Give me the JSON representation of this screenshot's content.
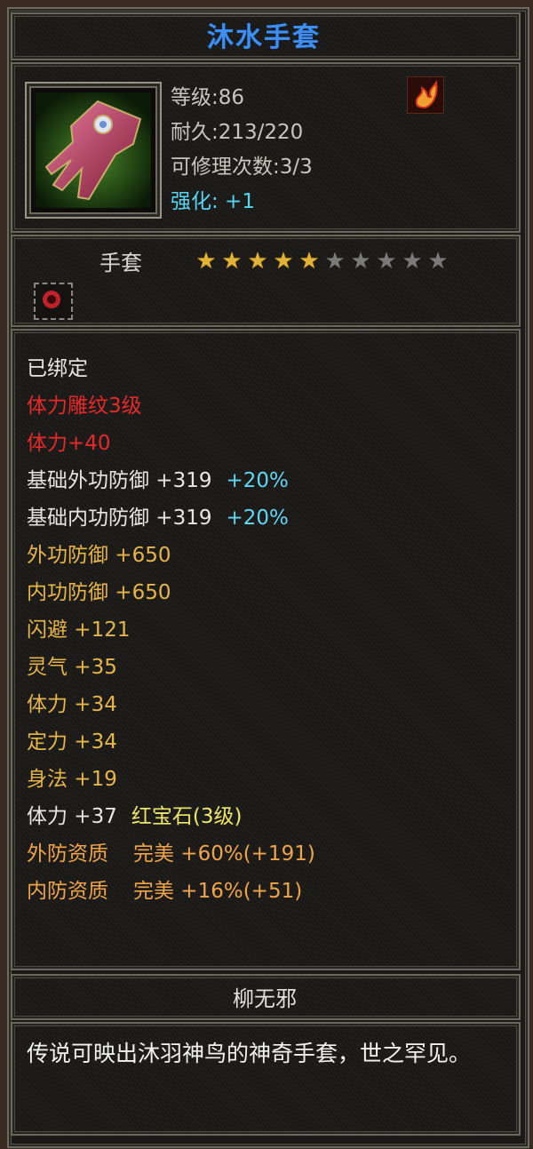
{
  "item": {
    "name": "沐水手套",
    "level": "等级:86",
    "durability": "耐久:213/220",
    "repair_count": "可修理次数:3/3",
    "enhance": "强化: +1",
    "type": "手套",
    "stars_filled": 5,
    "stars_total": 10,
    "icon": "gauntlet-icon",
    "element_icon": "fire-element-icon",
    "bind_icon": "bind-seal-icon"
  },
  "attributes": [
    {
      "parts": [
        {
          "text": "已绑定",
          "color": "white"
        }
      ]
    },
    {
      "parts": [
        {
          "text": "体力雕纹3级",
          "color": "red"
        }
      ]
    },
    {
      "parts": [
        {
          "text": "体力+40",
          "color": "red"
        }
      ]
    },
    {
      "parts": [
        {
          "text": "基础外功防御 +319",
          "color": "white"
        },
        {
          "text": "+20%",
          "color": "cyan"
        }
      ]
    },
    {
      "parts": [
        {
          "text": "基础内功防御 +319",
          "color": "white"
        },
        {
          "text": "+20%",
          "color": "cyan"
        }
      ]
    },
    {
      "parts": [
        {
          "text": "外功防御 +650",
          "color": "gold"
        }
      ]
    },
    {
      "parts": [
        {
          "text": "内功防御 +650",
          "color": "gold"
        }
      ]
    },
    {
      "parts": [
        {
          "text": "闪避 +121",
          "color": "gold"
        }
      ]
    },
    {
      "parts": [
        {
          "text": "灵气 +35",
          "color": "gold"
        }
      ]
    },
    {
      "parts": [
        {
          "text": "体力 +34",
          "color": "gold"
        }
      ]
    },
    {
      "parts": [
        {
          "text": "定力 +34",
          "color": "gold"
        }
      ]
    },
    {
      "parts": [
        {
          "text": "身法 +19",
          "color": "gold"
        }
      ]
    },
    {
      "parts": [
        {
          "text": "体力 +37",
          "color": "white"
        },
        {
          "text": "红宝石(3级)",
          "color": "yellow"
        }
      ]
    },
    {
      "parts": [
        {
          "text": "外防资质",
          "color": "orange"
        },
        {
          "text": "完美 +60%(+191)",
          "color": "orange"
        }
      ]
    },
    {
      "parts": [
        {
          "text": "内防资质",
          "color": "orange"
        },
        {
          "text": "完美 +16%(+51)",
          "color": "orange"
        }
      ]
    }
  ],
  "owner": "柳无邪",
  "description": "传说可映出沐羽神鸟的神奇手套，世之罕见。",
  "colors": {
    "title": "#3f8ff0",
    "white": "#e6e6e6",
    "red": "#e8292a",
    "gold": "#e7b64a",
    "cyan": "#5ed8f5",
    "orange": "#f0a54a",
    "yellow": "#efe76a"
  }
}
